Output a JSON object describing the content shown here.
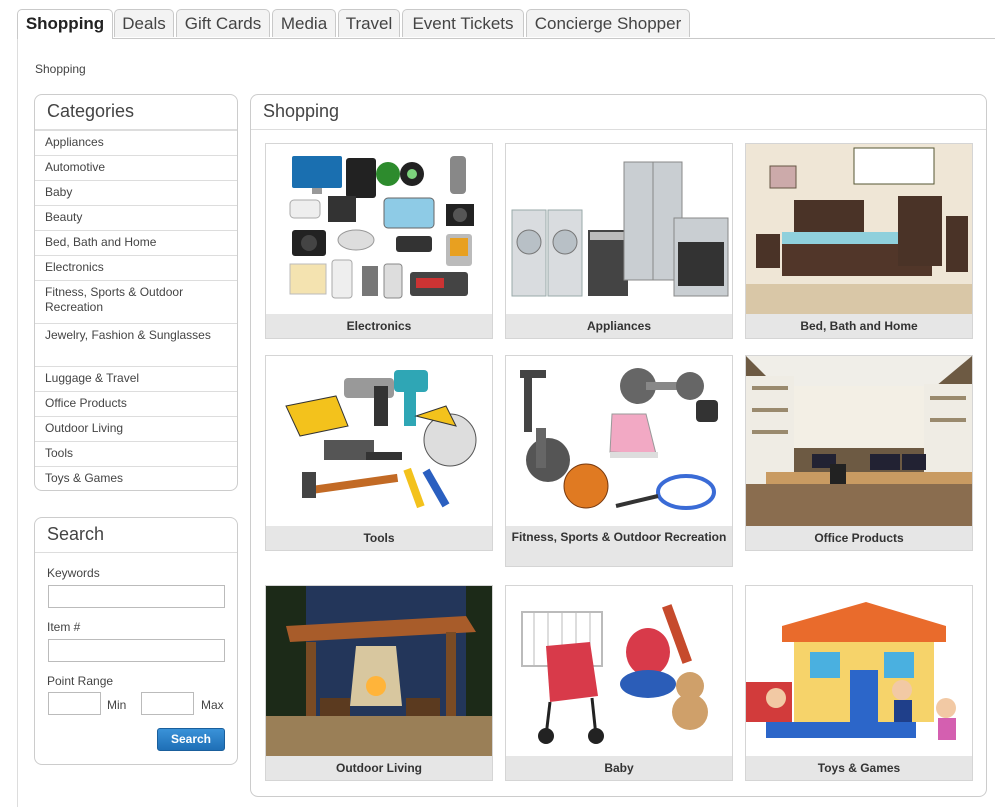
{
  "tabs": [
    {
      "label": "Shopping",
      "active": true
    },
    {
      "label": "Deals"
    },
    {
      "label": "Gift Cards"
    },
    {
      "label": "Media"
    },
    {
      "label": "Travel"
    },
    {
      "label": "Event Tickets"
    },
    {
      "label": "Concierge Shopper"
    }
  ],
  "breadcrumb": "Shopping",
  "categories": {
    "title": "Categories",
    "items": [
      "Appliances",
      "Automotive",
      "Baby",
      "Beauty",
      "Bed, Bath and Home",
      "Electronics",
      "Fitness, Sports & Outdoor Recreation",
      "Jewelry, Fashion & Sunglasses",
      "Luggage & Travel",
      "Office Products",
      "Outdoor Living",
      "Tools",
      "Toys & Games"
    ]
  },
  "search": {
    "title": "Search",
    "keywords_label": "Keywords",
    "keywords_value": "",
    "item_label": "Item #",
    "item_value": "",
    "range_label": "Point Range",
    "min_label": "Min",
    "min_value": "",
    "max_label": "Max",
    "max_value": "",
    "button_label": "Search"
  },
  "shopping": {
    "title": "Shopping",
    "tiles": [
      {
        "caption": "Electronics"
      },
      {
        "caption": "Appliances"
      },
      {
        "caption": "Bed, Bath and Home"
      },
      {
        "caption": "Tools"
      },
      {
        "caption": "Fitness, Sports & Outdoor Recreation"
      },
      {
        "caption": "Office Products"
      },
      {
        "caption": "Outdoor Living"
      },
      {
        "caption": "Baby"
      },
      {
        "caption": "Toys & Games"
      }
    ]
  },
  "colors": {
    "accent": "#2a7fc9",
    "tab_border": "#c9c9c9",
    "caption_bg": "#e6e6e6"
  }
}
